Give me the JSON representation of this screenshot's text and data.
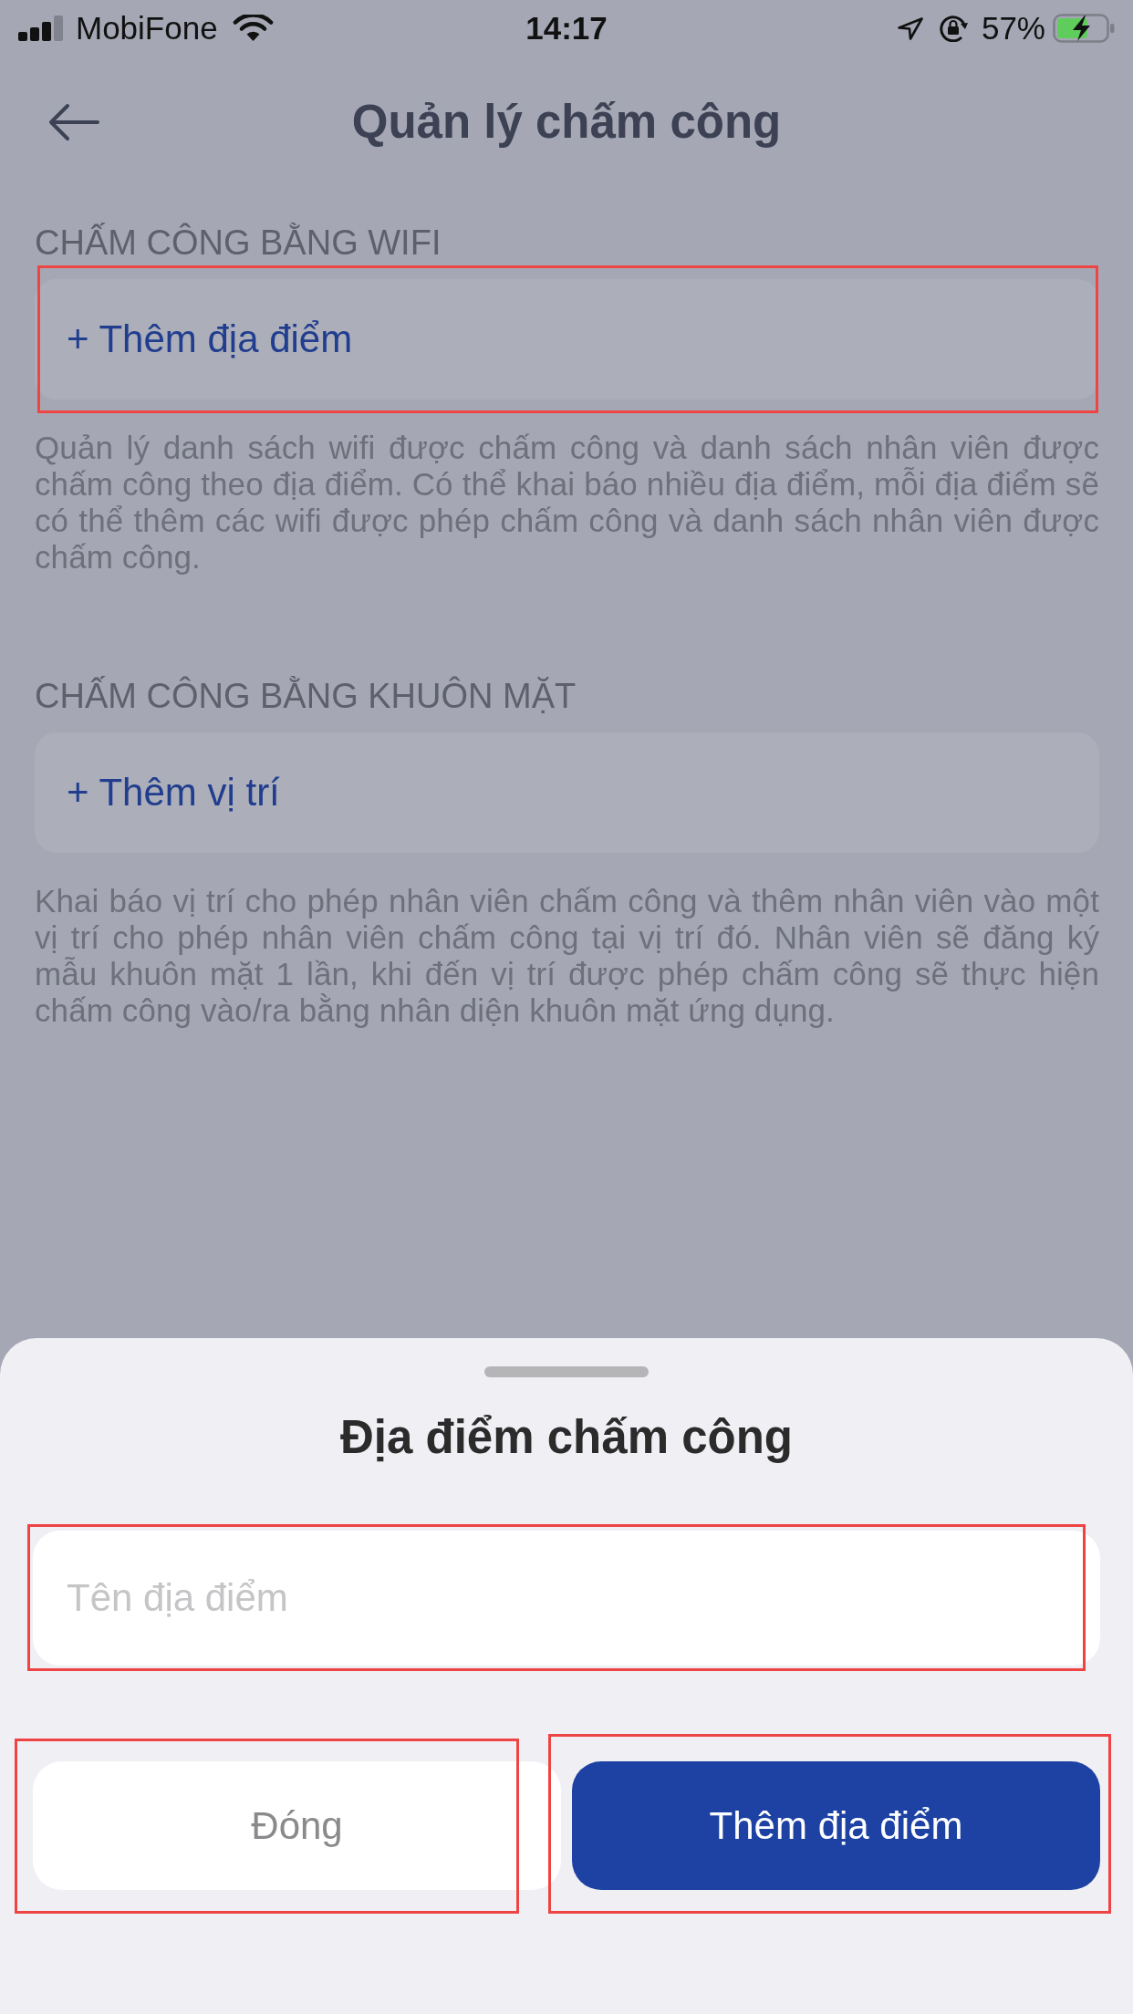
{
  "status_bar": {
    "carrier": "MobiFone",
    "time": "14:17",
    "battery_percent": "57%"
  },
  "header": {
    "title": "Quản lý chấm công"
  },
  "sections": [
    {
      "heading": "CHẤM CÔNG BẰNG WIFI",
      "action": "+ Thêm địa điểm",
      "highlighted": true,
      "description": "Quản lý danh sách wifi được chấm công và danh sách nhân viên được chấm công theo địa điểm. Có thể khai báo nhiều địa điểm, mỗi địa điểm sẽ có thể thêm các wifi được phép chấm công và danh sách nhân viên được chấm công."
    },
    {
      "heading": "CHẤM CÔNG BẰNG KHUÔN MẶT",
      "action": "+ Thêm vị trí",
      "highlighted": false,
      "description": "Khai báo vị trí cho phép nhân viên chấm công và thêm nhân viên vào một vị trí cho phép nhân viên chấm công tại vị trí đó. Nhân viên sẽ đăng ký mẫu khuôn mặt 1 lần, khi đến vị trí được phép chấm công sẽ thực hiện chấm công vào/ra bằng nhân diện khuôn mặt ứng dụng."
    }
  ],
  "sheet": {
    "title": "Địa điểm chấm công",
    "field": {
      "placeholder": "Tên địa điểm",
      "highlighted": true
    },
    "buttons": [
      {
        "label": "Đóng",
        "kind": "secondary",
        "highlighted": true
      },
      {
        "label": "Thêm địa điểm",
        "kind": "primary",
        "highlighted": true
      }
    ]
  }
}
